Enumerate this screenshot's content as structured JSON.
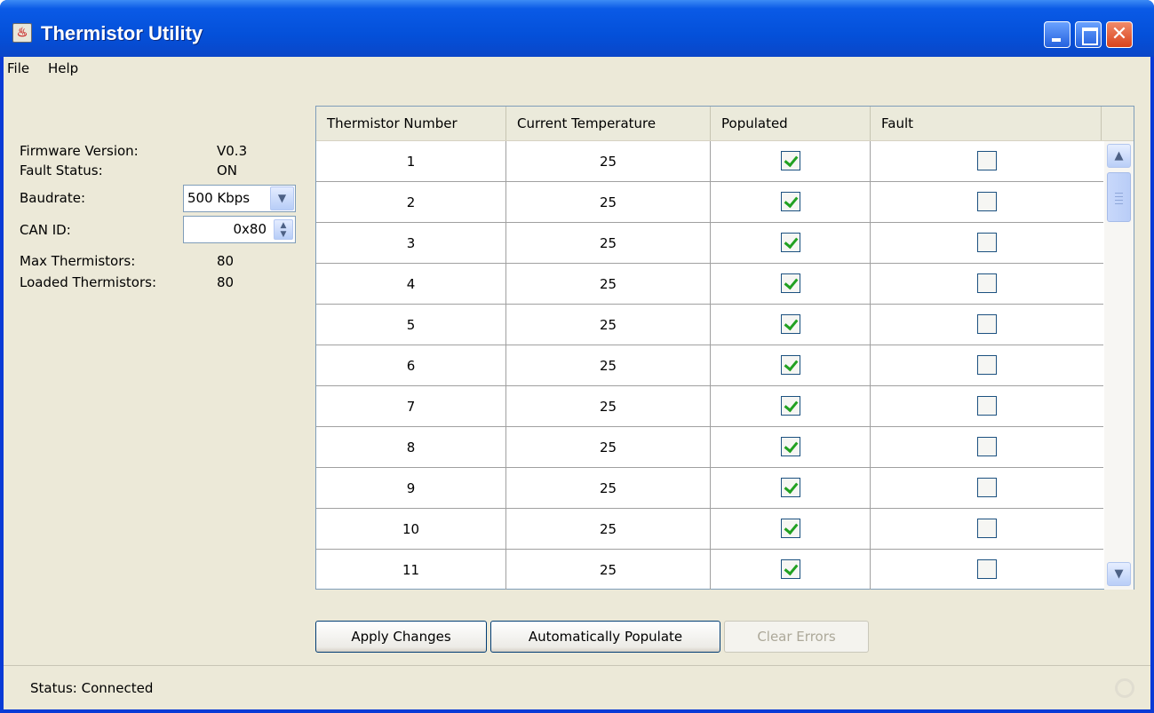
{
  "window": {
    "title": "Thermistor Utility"
  },
  "menu": [
    "File",
    "Help"
  ],
  "info": {
    "firmware_label": "Firmware Version:",
    "firmware_value": "V0.3",
    "fault_label": "Fault Status:",
    "fault_value": "ON",
    "baudrate_label": "Baudrate:",
    "baudrate_value": "500 Kbps",
    "canid_label": "CAN ID:",
    "canid_value": "0x80",
    "max_label": "Max Thermistors:",
    "max_value": "80",
    "loaded_label": "Loaded Thermistors:",
    "loaded_value": "80"
  },
  "table": {
    "columns": [
      "Thermistor Number",
      "Current Temperature",
      "Populated",
      "Fault"
    ],
    "rows": [
      {
        "number": "1",
        "temperature": "25",
        "populated": true,
        "fault": false
      },
      {
        "number": "2",
        "temperature": "25",
        "populated": true,
        "fault": false
      },
      {
        "number": "3",
        "temperature": "25",
        "populated": true,
        "fault": false
      },
      {
        "number": "4",
        "temperature": "25",
        "populated": true,
        "fault": false
      },
      {
        "number": "5",
        "temperature": "25",
        "populated": true,
        "fault": false
      },
      {
        "number": "6",
        "temperature": "25",
        "populated": true,
        "fault": false
      },
      {
        "number": "7",
        "temperature": "25",
        "populated": true,
        "fault": false
      },
      {
        "number": "8",
        "temperature": "25",
        "populated": true,
        "fault": false
      },
      {
        "number": "9",
        "temperature": "25",
        "populated": true,
        "fault": false
      },
      {
        "number": "10",
        "temperature": "25",
        "populated": true,
        "fault": false
      },
      {
        "number": "11",
        "temperature": "25",
        "populated": true,
        "fault": false
      }
    ]
  },
  "buttons": {
    "apply": "Apply Changes",
    "populate": "Automatically Populate",
    "clear": "Clear Errors"
  },
  "status": {
    "text": "Status: Connected"
  },
  "icons": {
    "app": "java-icon",
    "minimize": "minimize-icon",
    "maximize": "maximize-icon",
    "close": "close-icon",
    "dropdown": "chevron-down-icon",
    "spinner": "spinner-arrows-icon",
    "scroll_up": "scroll-up-icon",
    "scroll_down": "scroll-down-icon",
    "busy": "busy-indicator-icon"
  },
  "colors": {
    "titlebar": "#0a54e2",
    "client_bg": "#ece9d8",
    "check_green": "#21a121",
    "close_button": "#d9431c"
  }
}
